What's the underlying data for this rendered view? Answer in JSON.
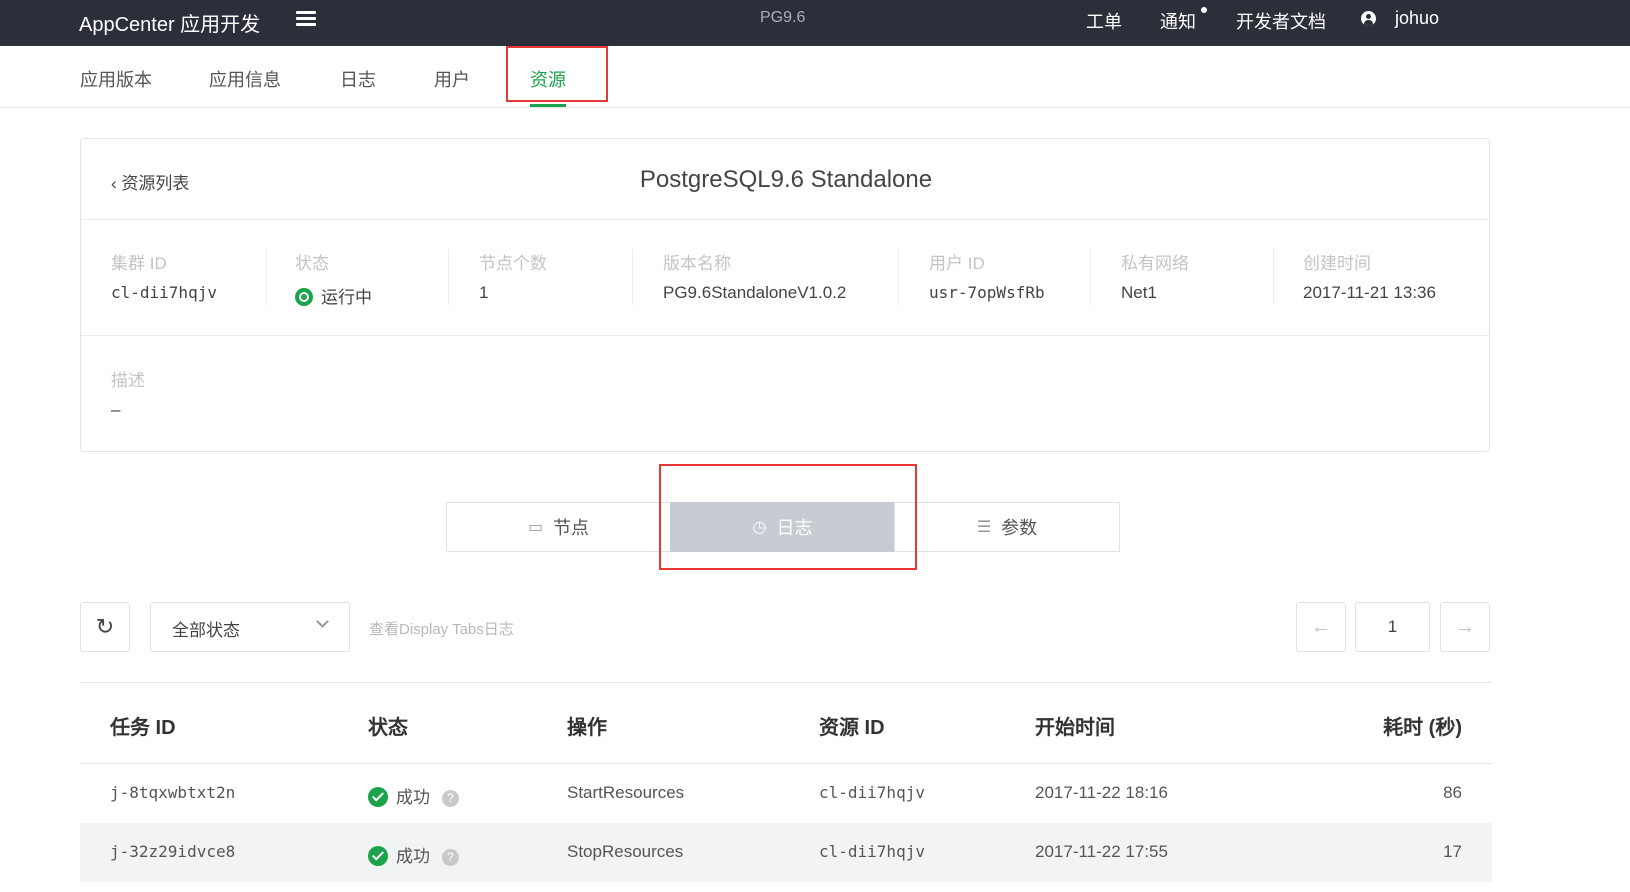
{
  "header": {
    "brand": "AppCenter 应用开发",
    "center_title": "PG9.6",
    "links": {
      "ticket": "工单",
      "notify": "通知",
      "docs": "开发者文档"
    },
    "user": "johuo"
  },
  "tabs": [
    "应用版本",
    "应用信息",
    "日志",
    "用户",
    "资源"
  ],
  "active_tab": "资源",
  "cluster": {
    "back_label": "资源列表",
    "title": "PostgreSQL9.6 Standalone",
    "fields": {
      "cluster_id": {
        "label": "集群 ID",
        "value": "cl-dii7hqjv"
      },
      "status": {
        "label": "状态",
        "value": "运行中"
      },
      "node_count": {
        "label": "节点个数",
        "value": "1"
      },
      "version": {
        "label": "版本名称",
        "value": "PG9.6StandaloneV1.0.2"
      },
      "user_id": {
        "label": "用户 ID",
        "value": "usr-7opWsfRb"
      },
      "vpc": {
        "label": "私有网络",
        "value": "Net1"
      },
      "created": {
        "label": "创建时间",
        "value": "2017-11-21 13:36"
      }
    },
    "description": {
      "label": "描述",
      "value": "–"
    }
  },
  "segments": [
    "节点",
    "日志",
    "参数"
  ],
  "active_segment": "日志",
  "toolbar": {
    "status_filter": "全部状态",
    "hint": "查看Display Tabs日志",
    "page": "1",
    "prev": "←",
    "next": "→"
  },
  "table": {
    "columns": [
      "任务 ID",
      "状态",
      "操作",
      "资源 ID",
      "开始时间",
      "耗时 (秒)"
    ],
    "rows": [
      {
        "job_id": "j-8tqxwbtxt2n",
        "status": "成功",
        "action": "StartResources",
        "resource_id": "cl-dii7hqjv",
        "start": "2017-11-22 18:16",
        "duration": "86"
      },
      {
        "job_id": "j-32z29idvce8",
        "status": "成功",
        "action": "StopResources",
        "resource_id": "cl-dii7hqjv",
        "start": "2017-11-22 17:55",
        "duration": "17"
      }
    ]
  },
  "colors": {
    "accent_green": "#1aa34a",
    "topbar_bg": "#2b2f3a",
    "highlight_red": "#e53935"
  }
}
